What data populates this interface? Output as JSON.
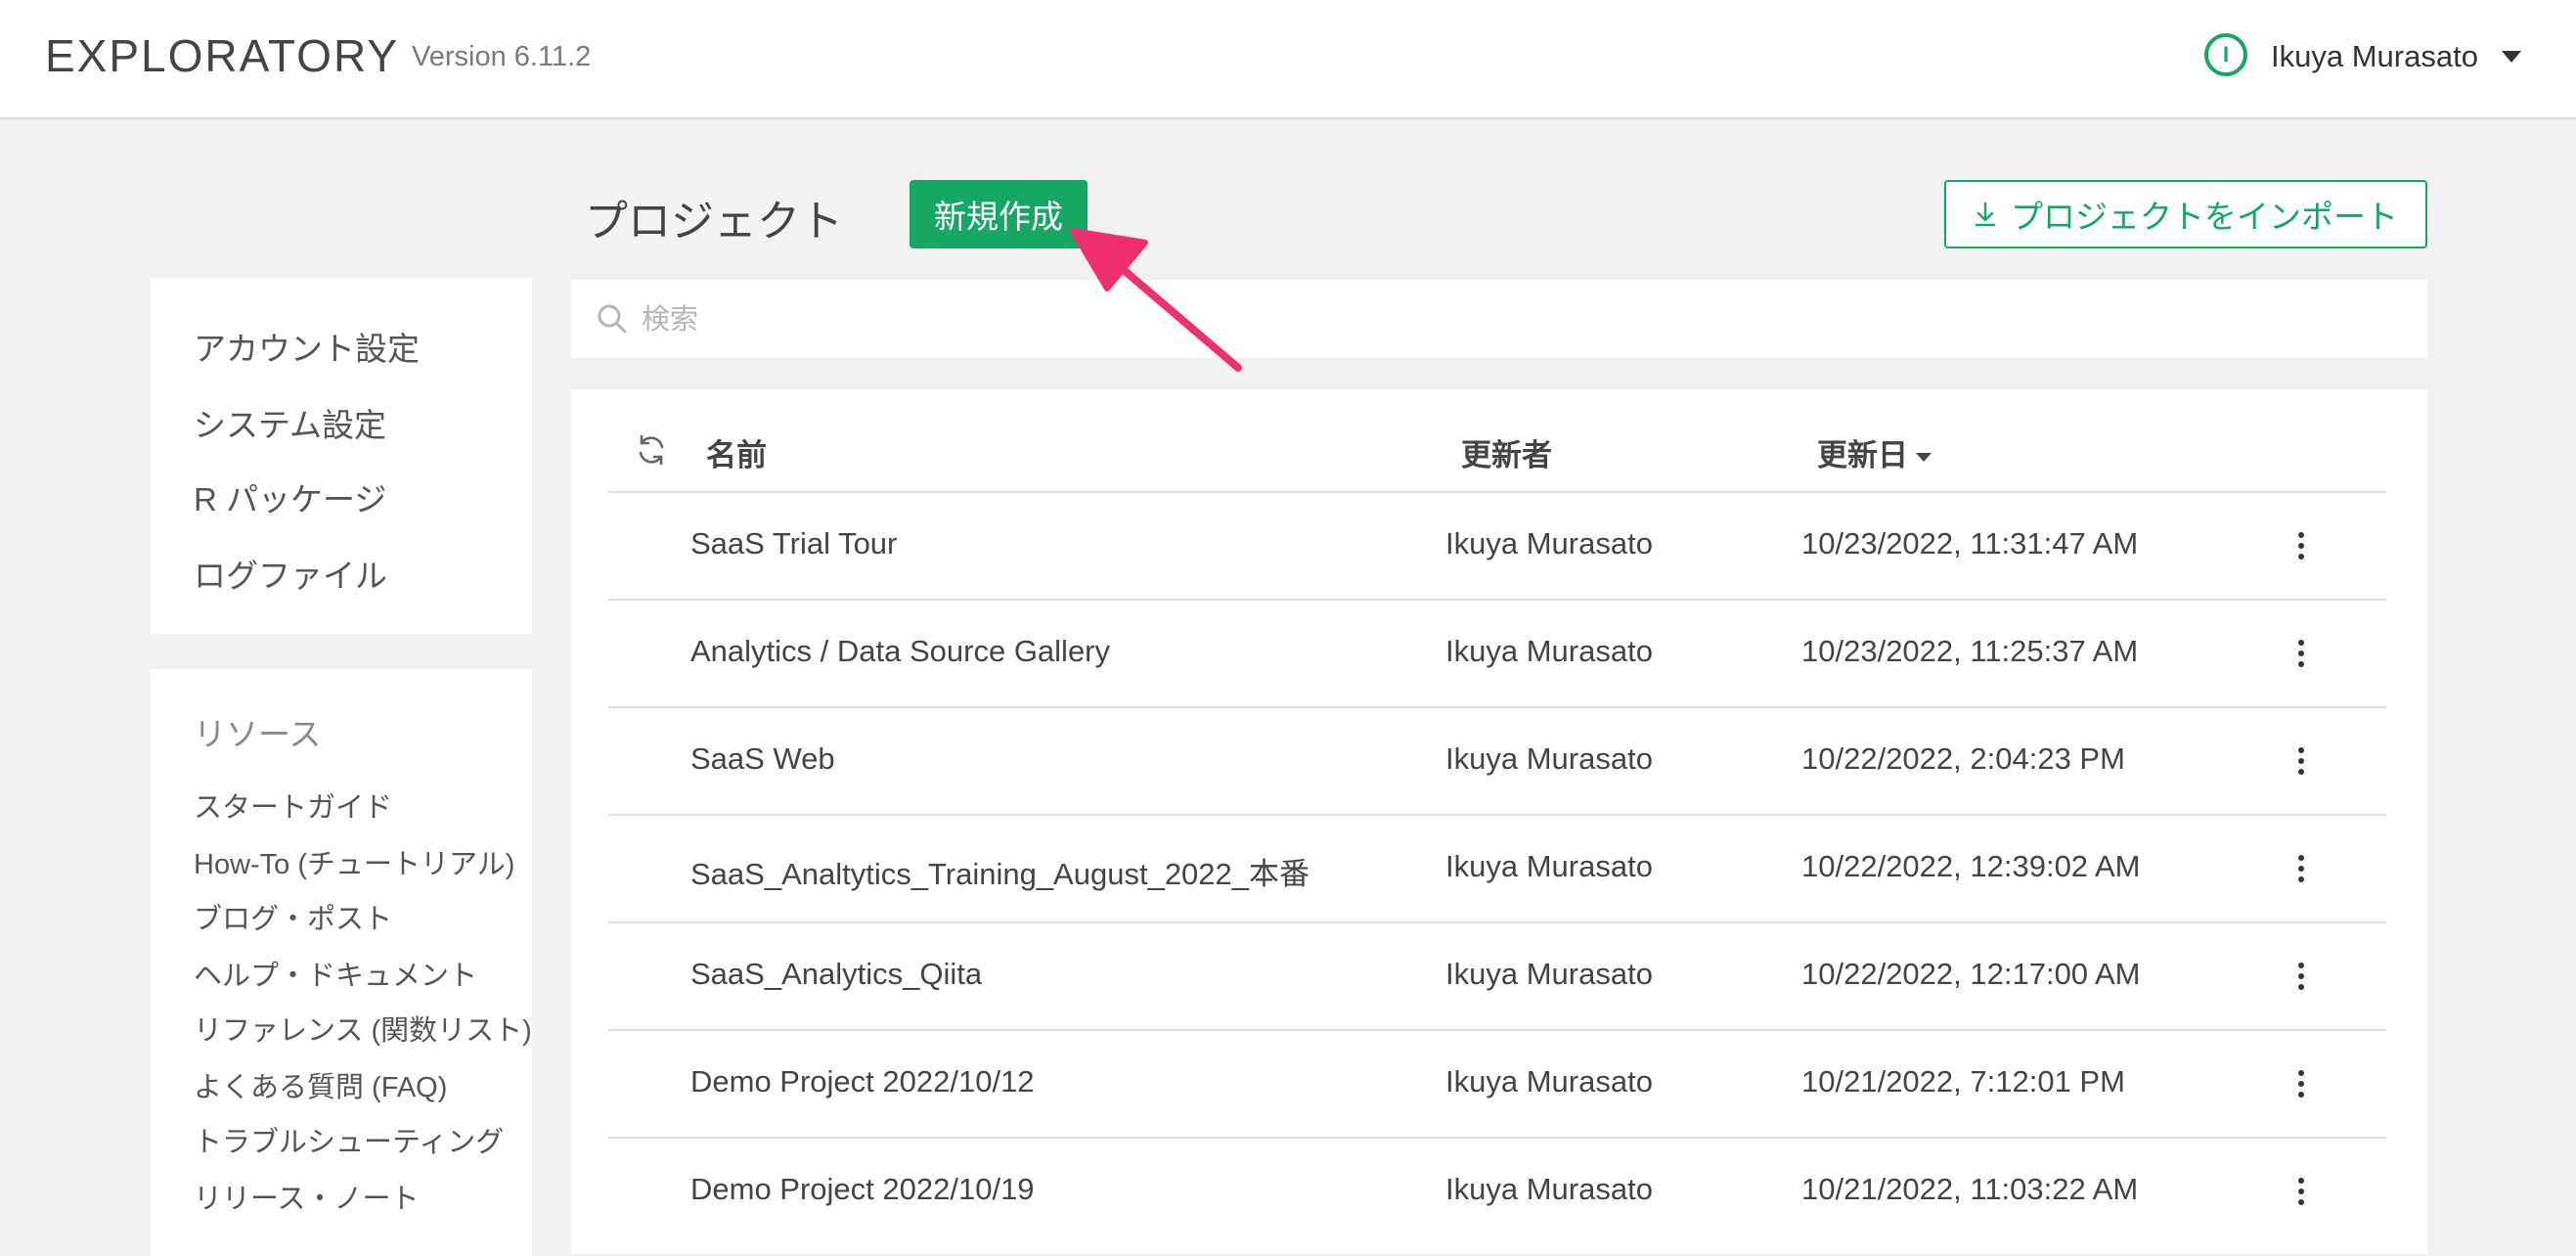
{
  "header": {
    "logo": "EXPLORATORY",
    "version": "Version 6.11.2",
    "avatar_letter": "I",
    "user_name": "Ikuya Murasato"
  },
  "sidebar": {
    "settings": [
      {
        "label": "アカウント設定"
      },
      {
        "label": "システム設定"
      },
      {
        "label": "R パッケージ"
      },
      {
        "label": "ログファイル"
      }
    ],
    "resources_title": "リソース",
    "resources": [
      {
        "label": "スタートガイド"
      },
      {
        "label": "How-To (チュートリアル)"
      },
      {
        "label": "ブログ・ポスト"
      },
      {
        "label": "ヘルプ・ドキュメント"
      },
      {
        "label": "リファレンス (関数リスト)"
      },
      {
        "label": "よくある質問 (FAQ)"
      },
      {
        "label": "トラブルシューティング"
      },
      {
        "label": "リリース・ノート"
      }
    ]
  },
  "main": {
    "title": "プロジェクト",
    "new_button": "新規作成",
    "import_button": "プロジェクトをインポート",
    "search_placeholder": "検索",
    "columns": {
      "name": "名前",
      "updated_by": "更新者",
      "updated_at": "更新日"
    },
    "rows": [
      {
        "name": "SaaS Trial Tour",
        "user": "Ikuya Murasato",
        "date": "10/23/2022, 11:31:47 AM"
      },
      {
        "name": "Analytics / Data Source Gallery",
        "user": "Ikuya Murasato",
        "date": "10/23/2022, 11:25:37 AM"
      },
      {
        "name": "SaaS Web",
        "user": "Ikuya Murasato",
        "date": "10/22/2022, 2:04:23 PM"
      },
      {
        "name": "SaaS_Analtytics_Training_August_2022_本番",
        "user": "Ikuya Murasato",
        "date": "10/22/2022, 12:39:02 AM"
      },
      {
        "name": "SaaS_Analytics_Qiita",
        "user": "Ikuya Murasato",
        "date": "10/22/2022, 12:17:00 AM"
      },
      {
        "name": "Demo Project 2022/10/12",
        "user": "Ikuya Murasato",
        "date": "10/21/2022, 7:12:01 PM"
      },
      {
        "name": "Demo Project 2022/10/19",
        "user": "Ikuya Murasato",
        "date": "10/21/2022, 11:03:22 AM"
      }
    ]
  },
  "colors": {
    "accent": "#17a765",
    "annotation_arrow": "#f0306e"
  },
  "icons": [
    "user-avatar-icon",
    "chevron-down-icon",
    "download-icon",
    "search-icon",
    "refresh-icon",
    "sort-desc-icon",
    "more-vertical-icon",
    "annotation-arrow"
  ]
}
